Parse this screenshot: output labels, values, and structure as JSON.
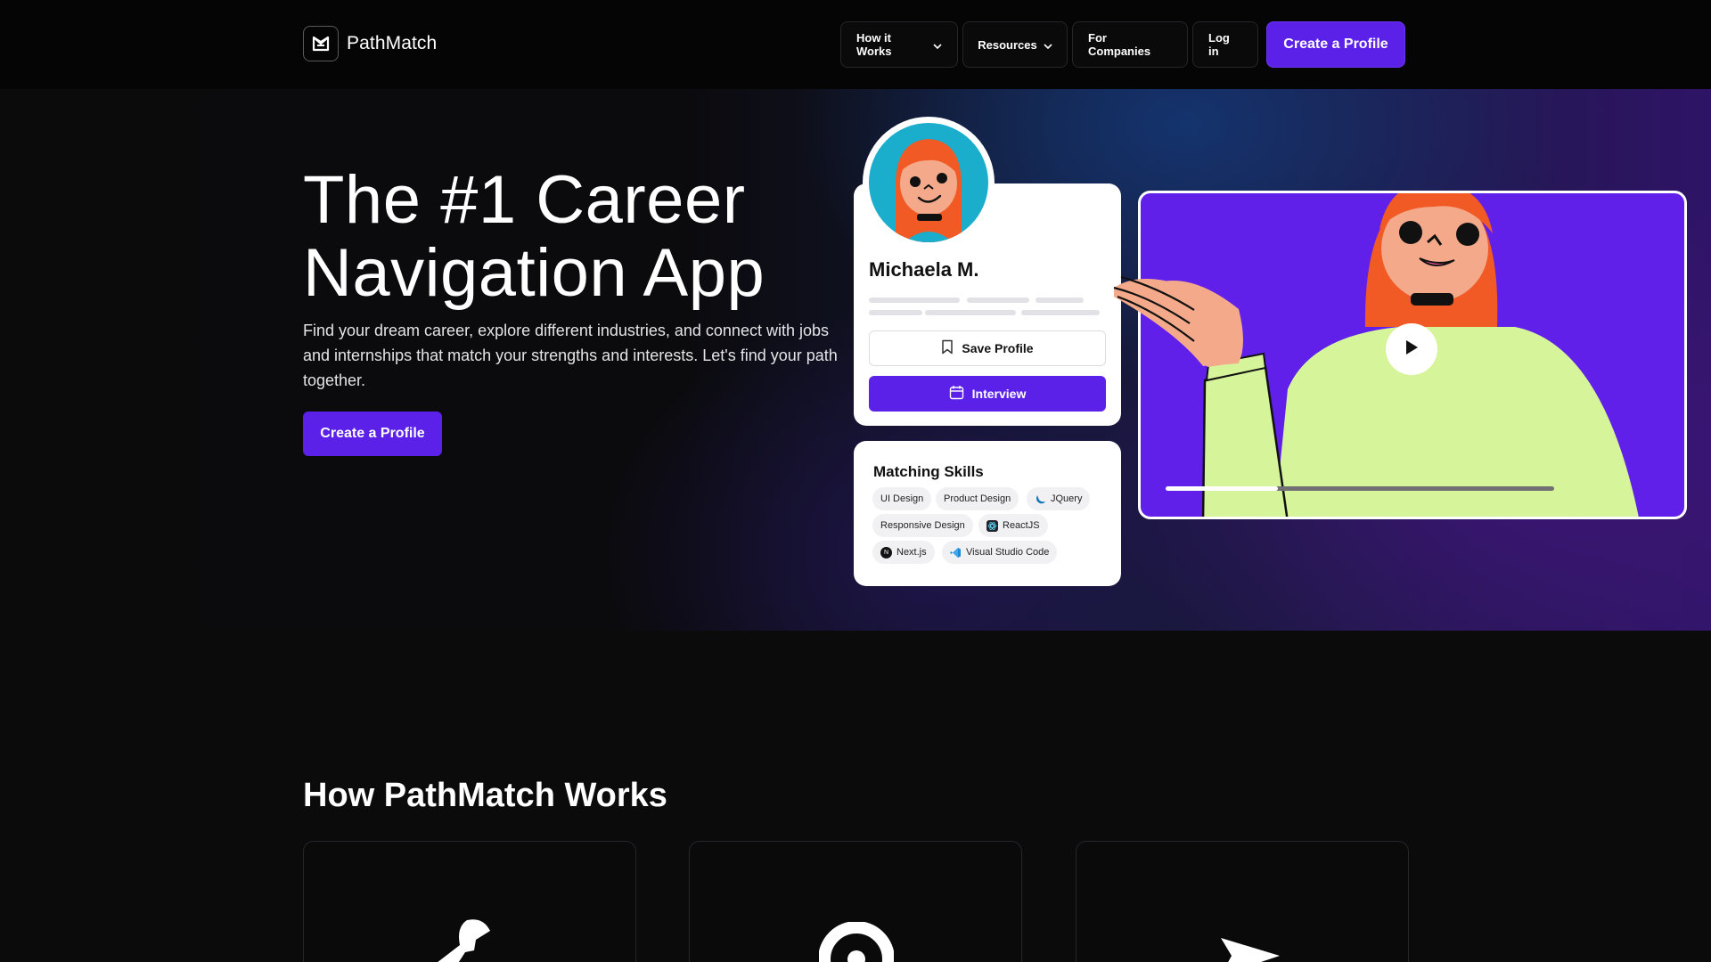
{
  "header": {
    "brand": "PathMatch",
    "nav": {
      "how_it_works": "How it Works",
      "resources": "Resources",
      "for_companies": "For Companies",
      "login": "Log in",
      "create_profile": "Create a Profile"
    }
  },
  "hero": {
    "title_line1": "The #1 Career",
    "title_line2": "Navigation App",
    "subtitle": "Find your dream career, explore different industries, and connect with jobs and internships that match your strengths and interests. Let's find your path together.",
    "cta": "Create a Profile"
  },
  "profile_card": {
    "name": "Michaela M.",
    "save_label": "Save Profile",
    "interview_label": "Interview"
  },
  "skills_card": {
    "title": "Matching Skills",
    "skills": [
      {
        "label": "UI Design",
        "icon": ""
      },
      {
        "label": "Product Design",
        "icon": ""
      },
      {
        "label": "JQuery",
        "icon": "jquery-icon"
      },
      {
        "label": "Responsive Design",
        "icon": ""
      },
      {
        "label": "ReactJS",
        "icon": "react-icon"
      },
      {
        "label": "Next.js",
        "icon": "nextjs-icon"
      },
      {
        "label": "Visual Studio Code",
        "icon": "vscode-icon"
      }
    ]
  },
  "video": {
    "progress": 0.29
  },
  "how_section": {
    "title": "How PathMatch Works",
    "cards": [
      {
        "icon": "wrench-icon"
      },
      {
        "icon": "target-icon"
      },
      {
        "icon": "send-icon"
      }
    ]
  },
  "colors": {
    "accent": "#5b21e8",
    "background": "#0b0b0c",
    "video_bg": "#6020ea"
  }
}
